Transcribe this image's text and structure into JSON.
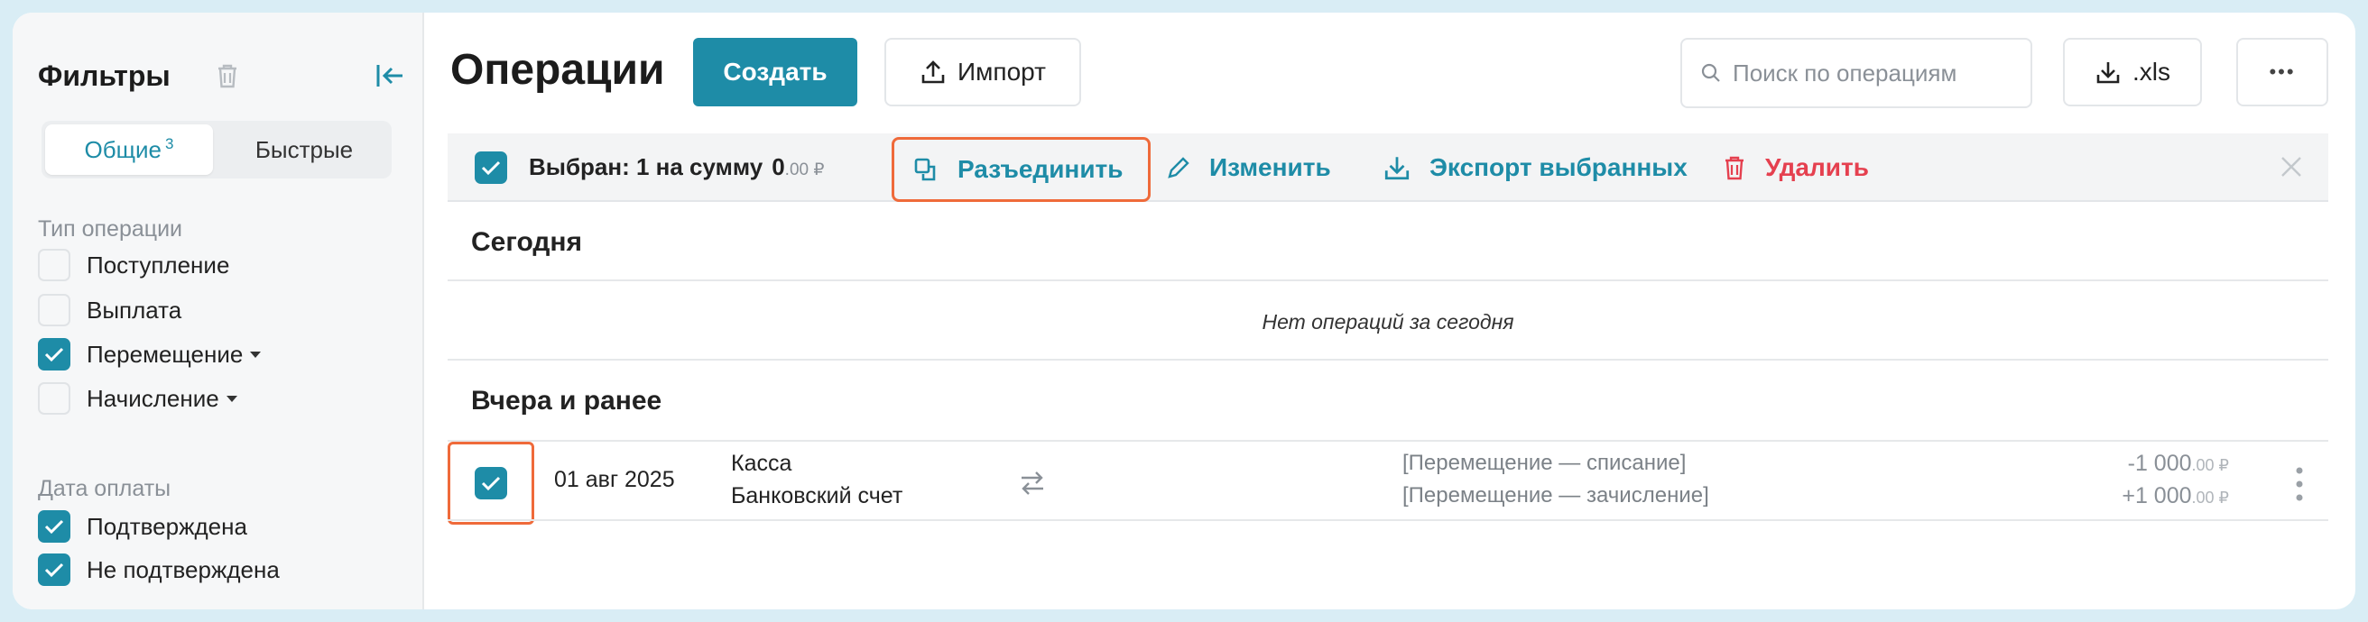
{
  "sidebar": {
    "title": "Фильтры",
    "tabs": [
      {
        "label": "Общие",
        "badge": "3"
      },
      {
        "label": "Быстрые"
      }
    ],
    "groups": [
      {
        "title": "Тип операции",
        "items": [
          {
            "label": "Поступление",
            "checked": false
          },
          {
            "label": "Выплата",
            "checked": false
          },
          {
            "label": "Перемещение",
            "checked": true
          },
          {
            "label": "Начисление",
            "checked": false
          }
        ]
      },
      {
        "title": "Дата оплаты",
        "items": [
          {
            "label": "Подтверждена",
            "checked": true
          },
          {
            "label": "Не подтверждена",
            "checked": true
          }
        ]
      }
    ]
  },
  "header": {
    "title": "Операции",
    "create_label": "Создать",
    "import_label": "Импорт",
    "search_placeholder": "Поиск по операциям",
    "export_xls_label": ".xls",
    "more_label": "•••"
  },
  "selection": {
    "label": "Выбран: 1 на сумму",
    "amount": "0",
    "amount_fraction": ".00 ₽",
    "actions": {
      "split": "Разъединить",
      "edit": "Изменить",
      "export": "Экспорт выбранных",
      "delete": "Удалить"
    }
  },
  "sections": {
    "today": {
      "title": "Сегодня",
      "empty": "Нет операций за сегодня"
    },
    "earlier": {
      "title": "Вчера и ранее"
    }
  },
  "operations": [
    {
      "date": "01 авг 2025",
      "from": "Касса",
      "to": "Банковский счет",
      "desc_out": "[Перемещение — списание]",
      "desc_in": "[Перемещение — зачисление]",
      "amount_out": "-1 000",
      "amount_in": "+1 000",
      "fraction": ".00 ₽",
      "selected": true
    }
  ],
  "colors": {
    "accent": "#1e8ca7",
    "danger": "#e5404f",
    "highlight": "#ef6a3a"
  }
}
